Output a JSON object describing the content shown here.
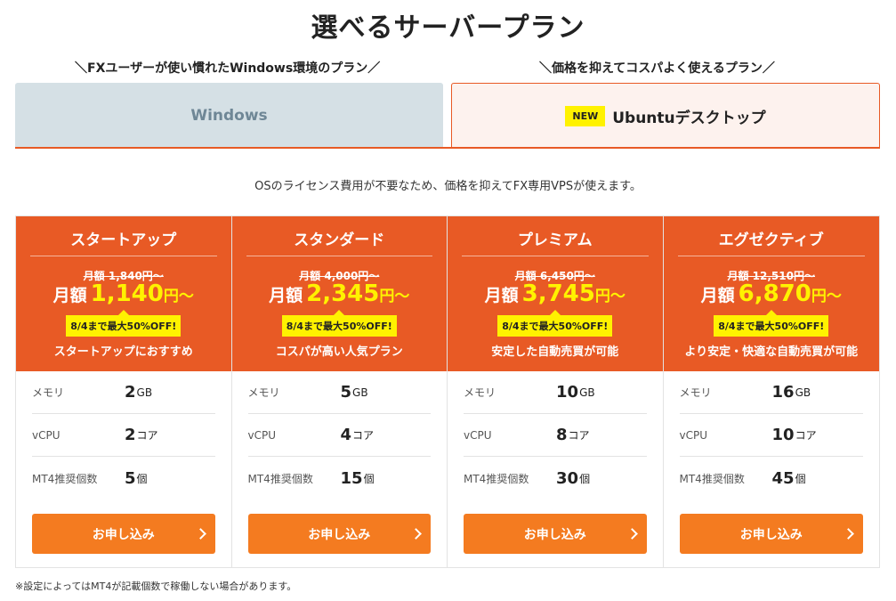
{
  "title": "選べるサーバープラン",
  "subtitles": {
    "left": "＼FXユーザーが使い慣れたWindows環境のプラン／",
    "right": "＼価格を抑えてコスパよく使えるプラン／"
  },
  "tabs": {
    "windows": "Windows",
    "ubuntu_badge": "NEW",
    "ubuntu": "Ubuntuデスクトップ"
  },
  "description": "OSのライセンス費用が不要なため、価格を抑えてFX専用VPSが使えます。",
  "spec_labels": {
    "memory": "メモリ",
    "vcpu": "vCPU",
    "mt4": "MT4推奨個数"
  },
  "plans": [
    {
      "name": "スタートアップ",
      "old_price": "月額 1,840円〜",
      "price_prefix": "月額",
      "price": "1,140",
      "price_unit": "円〜",
      "campaign": "8/4まで最大50%OFF!",
      "catch": "スタートアップにおすすめ",
      "memory": "2",
      "memory_unit": "GB",
      "vcpu": "2",
      "vcpu_unit": "コア",
      "mt4": "5",
      "mt4_unit": "個",
      "button": "お申し込み"
    },
    {
      "name": "スタンダード",
      "old_price": "月額 4,000円〜",
      "price_prefix": "月額",
      "price": "2,345",
      "price_unit": "円〜",
      "campaign": "8/4まで最大50%OFF!",
      "catch": "コスパが高い人気プラン",
      "memory": "5",
      "memory_unit": "GB",
      "vcpu": "4",
      "vcpu_unit": "コア",
      "mt4": "15",
      "mt4_unit": "個",
      "button": "お申し込み"
    },
    {
      "name": "プレミアム",
      "old_price": "月額 6,450円〜",
      "price_prefix": "月額",
      "price": "3,745",
      "price_unit": "円〜",
      "campaign": "8/4まで最大50%OFF!",
      "catch": "安定した自動売買が可能",
      "memory": "10",
      "memory_unit": "GB",
      "vcpu": "8",
      "vcpu_unit": "コア",
      "mt4": "30",
      "mt4_unit": "個",
      "button": "お申し込み"
    },
    {
      "name": "エグゼクティブ",
      "old_price": "月額 12,510円〜",
      "price_prefix": "月額",
      "price": "6,870",
      "price_unit": "円〜",
      "campaign": "8/4まで最大50%OFF!",
      "catch": "より安定・快適な自動売買が可能",
      "memory": "16",
      "memory_unit": "GB",
      "vcpu": "10",
      "vcpu_unit": "コア",
      "mt4": "45",
      "mt4_unit": "個",
      "button": "お申し込み"
    }
  ],
  "footnote": "※設定によってはMT4が記載個数で稼働しない場合があります。",
  "colors": {
    "accent": "#e85a25",
    "button": "#f47b20",
    "highlight": "#fff200",
    "windows_tab": "#d5e0e5"
  }
}
